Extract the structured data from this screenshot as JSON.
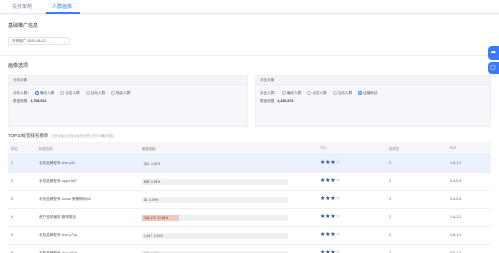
{
  "tabs": [
    {
      "label": "投放策略"
    },
    {
      "label": "人群画像"
    }
  ],
  "basic": {
    "title": "基础推广信息",
    "date_value": "开车推广 2020-06-12",
    "chevron": "chevron-down-icon"
  },
  "portrait": {
    "title": "画像选项",
    "left": {
      "head": "分析对象",
      "row_label": "分析人群：",
      "options": [
        "曝光人群",
        "点击人群",
        "互动人群",
        "购买人群"
      ],
      "selected": 0,
      "cover_label": "覆盖规模",
      "cover_value": "1,708,912"
    },
    "right": {
      "head": "对比对象",
      "row_label": "对比人群：",
      "options": [
        "曝光人群",
        "点击人群",
        "互动人群",
        "店铺粉丝"
      ],
      "selected": 3,
      "cover_label": "覆盖规模",
      "cover_value": "4,436,574"
    }
  },
  "top": {
    "title": "TOP10标签排名榜单",
    "subtitle": "分析对象与比较对象在标签上的TGI偏好指标"
  },
  "table": {
    "headers": [
      "排名",
      "标签名称",
      "覆盖规模",
      "TGI",
      "相关性",
      "ROI"
    ],
    "rows": [
      {
        "rank": "1",
        "name": "手机品牌型号-vivo y31",
        "cov": "324",
        "pct": "0.32%",
        "fill": 0.03,
        "stars": 3,
        "rel": "3",
        "roi": "1.6-1.2",
        "active": true
      },
      {
        "rank": "2",
        "name": "手机品牌型号-oppo a57",
        "cov": "808",
        "pct": "0.59%",
        "fill": 0.06,
        "stars": 3,
        "rel": "3",
        "roi": "0.4-0.4",
        "active": false
      },
      {
        "rank": "3",
        "name": "手机品牌型号-honor 荣耀畅玩5A",
        "cov": "81",
        "pct": "0.09%",
        "fill": 0.01,
        "stars": 3,
        "rel": "3",
        "roi": "0.4-0.5",
        "active": false
      },
      {
        "rank": "4",
        "name": "资产品类偏好-服饰鞋包",
        "cov": "348,173",
        "pct": "21.68%",
        "fill": 0.25,
        "stars": 3,
        "rel": "2",
        "roi": "1.6-1.2",
        "active": false,
        "highlight": true
      },
      {
        "rank": "5",
        "name": "手机品牌型号-vivo y71a",
        "cov": "1,647",
        "pct": "0.10%",
        "fill": 0.01,
        "stars": 3,
        "rel": "2",
        "roi": "1.8-1.2",
        "active": false
      },
      {
        "rank": "6",
        "name": "手机品牌型号-vivo y51a",
        "cov": "288",
        "pct": "0.02%",
        "fill": 0.01,
        "stars": 3,
        "rel": "2",
        "roi": "3.5-1.2",
        "active": false
      }
    ]
  },
  "float": {
    "b1_icon": "cloud-icon",
    "b2_icon": "message-icon"
  },
  "colors": {
    "accent": "#3a7bfa",
    "star": "#2f4f97",
    "highlight_bar": "#f5c7b8"
  }
}
